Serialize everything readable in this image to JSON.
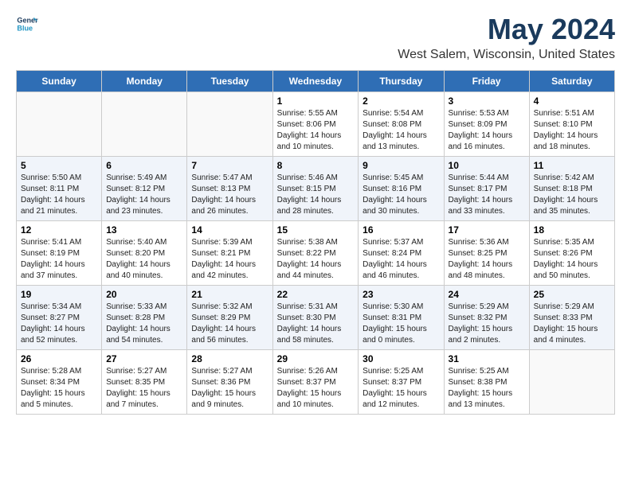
{
  "header": {
    "logo_line1": "General",
    "logo_line2": "Blue",
    "title": "May 2024",
    "subtitle": "West Salem, Wisconsin, United States"
  },
  "calendar": {
    "days_of_week": [
      "Sunday",
      "Monday",
      "Tuesday",
      "Wednesday",
      "Thursday",
      "Friday",
      "Saturday"
    ],
    "weeks": [
      [
        {
          "day": "",
          "info": ""
        },
        {
          "day": "",
          "info": ""
        },
        {
          "day": "",
          "info": ""
        },
        {
          "day": "1",
          "info": "Sunrise: 5:55 AM\nSunset: 8:06 PM\nDaylight: 14 hours\nand 10 minutes."
        },
        {
          "day": "2",
          "info": "Sunrise: 5:54 AM\nSunset: 8:08 PM\nDaylight: 14 hours\nand 13 minutes."
        },
        {
          "day": "3",
          "info": "Sunrise: 5:53 AM\nSunset: 8:09 PM\nDaylight: 14 hours\nand 16 minutes."
        },
        {
          "day": "4",
          "info": "Sunrise: 5:51 AM\nSunset: 8:10 PM\nDaylight: 14 hours\nand 18 minutes."
        }
      ],
      [
        {
          "day": "5",
          "info": "Sunrise: 5:50 AM\nSunset: 8:11 PM\nDaylight: 14 hours\nand 21 minutes."
        },
        {
          "day": "6",
          "info": "Sunrise: 5:49 AM\nSunset: 8:12 PM\nDaylight: 14 hours\nand 23 minutes."
        },
        {
          "day": "7",
          "info": "Sunrise: 5:47 AM\nSunset: 8:13 PM\nDaylight: 14 hours\nand 26 minutes."
        },
        {
          "day": "8",
          "info": "Sunrise: 5:46 AM\nSunset: 8:15 PM\nDaylight: 14 hours\nand 28 minutes."
        },
        {
          "day": "9",
          "info": "Sunrise: 5:45 AM\nSunset: 8:16 PM\nDaylight: 14 hours\nand 30 minutes."
        },
        {
          "day": "10",
          "info": "Sunrise: 5:44 AM\nSunset: 8:17 PM\nDaylight: 14 hours\nand 33 minutes."
        },
        {
          "day": "11",
          "info": "Sunrise: 5:42 AM\nSunset: 8:18 PM\nDaylight: 14 hours\nand 35 minutes."
        }
      ],
      [
        {
          "day": "12",
          "info": "Sunrise: 5:41 AM\nSunset: 8:19 PM\nDaylight: 14 hours\nand 37 minutes."
        },
        {
          "day": "13",
          "info": "Sunrise: 5:40 AM\nSunset: 8:20 PM\nDaylight: 14 hours\nand 40 minutes."
        },
        {
          "day": "14",
          "info": "Sunrise: 5:39 AM\nSunset: 8:21 PM\nDaylight: 14 hours\nand 42 minutes."
        },
        {
          "day": "15",
          "info": "Sunrise: 5:38 AM\nSunset: 8:22 PM\nDaylight: 14 hours\nand 44 minutes."
        },
        {
          "day": "16",
          "info": "Sunrise: 5:37 AM\nSunset: 8:24 PM\nDaylight: 14 hours\nand 46 minutes."
        },
        {
          "day": "17",
          "info": "Sunrise: 5:36 AM\nSunset: 8:25 PM\nDaylight: 14 hours\nand 48 minutes."
        },
        {
          "day": "18",
          "info": "Sunrise: 5:35 AM\nSunset: 8:26 PM\nDaylight: 14 hours\nand 50 minutes."
        }
      ],
      [
        {
          "day": "19",
          "info": "Sunrise: 5:34 AM\nSunset: 8:27 PM\nDaylight: 14 hours\nand 52 minutes."
        },
        {
          "day": "20",
          "info": "Sunrise: 5:33 AM\nSunset: 8:28 PM\nDaylight: 14 hours\nand 54 minutes."
        },
        {
          "day": "21",
          "info": "Sunrise: 5:32 AM\nSunset: 8:29 PM\nDaylight: 14 hours\nand 56 minutes."
        },
        {
          "day": "22",
          "info": "Sunrise: 5:31 AM\nSunset: 8:30 PM\nDaylight: 14 hours\nand 58 minutes."
        },
        {
          "day": "23",
          "info": "Sunrise: 5:30 AM\nSunset: 8:31 PM\nDaylight: 15 hours\nand 0 minutes."
        },
        {
          "day": "24",
          "info": "Sunrise: 5:29 AM\nSunset: 8:32 PM\nDaylight: 15 hours\nand 2 minutes."
        },
        {
          "day": "25",
          "info": "Sunrise: 5:29 AM\nSunset: 8:33 PM\nDaylight: 15 hours\nand 4 minutes."
        }
      ],
      [
        {
          "day": "26",
          "info": "Sunrise: 5:28 AM\nSunset: 8:34 PM\nDaylight: 15 hours\nand 5 minutes."
        },
        {
          "day": "27",
          "info": "Sunrise: 5:27 AM\nSunset: 8:35 PM\nDaylight: 15 hours\nand 7 minutes."
        },
        {
          "day": "28",
          "info": "Sunrise: 5:27 AM\nSunset: 8:36 PM\nDaylight: 15 hours\nand 9 minutes."
        },
        {
          "day": "29",
          "info": "Sunrise: 5:26 AM\nSunset: 8:37 PM\nDaylight: 15 hours\nand 10 minutes."
        },
        {
          "day": "30",
          "info": "Sunrise: 5:25 AM\nSunset: 8:37 PM\nDaylight: 15 hours\nand 12 minutes."
        },
        {
          "day": "31",
          "info": "Sunrise: 5:25 AM\nSunset: 8:38 PM\nDaylight: 15 hours\nand 13 minutes."
        },
        {
          "day": "",
          "info": ""
        }
      ]
    ]
  }
}
